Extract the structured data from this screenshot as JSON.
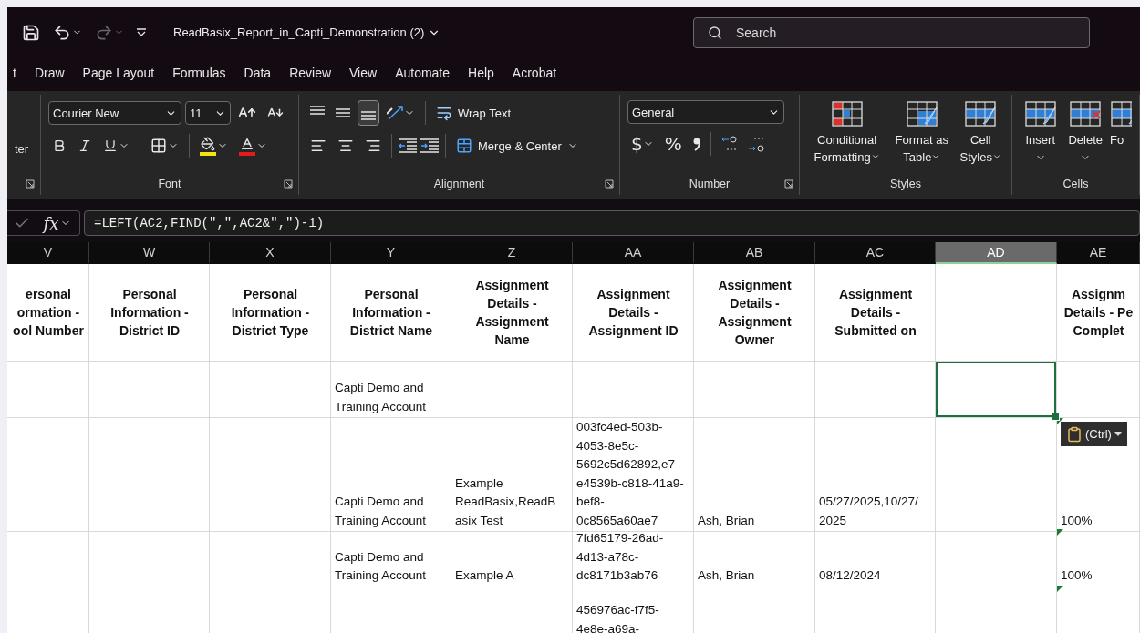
{
  "title_bar": {
    "document_title": "ReadBasix_Report_in_Capti_Demonstration (2)",
    "search": {
      "placeholder": "Search"
    }
  },
  "menu_tabs": [
    {
      "label": "t",
      "selected": false
    },
    {
      "label": "Draw",
      "selected": false
    },
    {
      "label": "Page Layout",
      "selected": false
    },
    {
      "label": "Formulas",
      "selected": false
    },
    {
      "label": "Data",
      "selected": false
    },
    {
      "label": "Review",
      "selected": false
    },
    {
      "label": "View",
      "selected": false
    },
    {
      "label": "Automate",
      "selected": false
    },
    {
      "label": "Help",
      "selected": false
    },
    {
      "label": "Acrobat",
      "selected": false
    }
  ],
  "ribbon": {
    "clipboard": {
      "partial_label": "ter"
    },
    "font": {
      "name": "Courier New",
      "size": "11",
      "label": "Font"
    },
    "alignment": {
      "vertical": [
        {
          "selected": false
        },
        {
          "selected": false
        },
        {
          "selected": true
        }
      ],
      "wrap_text": "Wrap Text",
      "merge": "Merge & Center",
      "label": "Alignment"
    },
    "number": {
      "format": "General",
      "currency": "$",
      "percent": "%",
      "label": "Number"
    },
    "styles": {
      "buttons": [
        "Conditional Formatting",
        "Format as Table",
        "Cell Styles"
      ],
      "label": "Styles"
    },
    "cells": {
      "buttons": [
        "Insert",
        "Delete",
        "Fo"
      ],
      "label": "Cells"
    }
  },
  "formula_bar": {
    "fx": "fx",
    "formula": "=LEFT(AC2,FIND(\",\",AC2&\",\")-1)"
  },
  "sheet": {
    "columns": [
      {
        "label": "V",
        "selected": false,
        "header": "ersonal\normation -\nool Number"
      },
      {
        "label": "W",
        "selected": false,
        "header": "Personal\nInformation -\nDistrict ID"
      },
      {
        "label": "X",
        "selected": false,
        "header": "Personal\nInformation -\nDistrict Type"
      },
      {
        "label": "Y",
        "selected": false,
        "header": "Personal\nInformation -\nDistrict Name"
      },
      {
        "label": "Z",
        "selected": false,
        "header": "Assignment\nDetails -\nAssignment\nName"
      },
      {
        "label": "AA",
        "selected": false,
        "header": "Assignment\nDetails -\nAssignment ID"
      },
      {
        "label": "AB",
        "selected": false,
        "header": "Assignment\nDetails -\nAssignment\nOwner"
      },
      {
        "label": "AC",
        "selected": false,
        "header": "Assignment\nDetails -\nSubmitted on"
      },
      {
        "label": "AD",
        "selected": true
      },
      {
        "label": "AE",
        "selected": false,
        "header": "Assignm\nDetails - Pe\nComplet"
      }
    ],
    "rows": [
      {
        "selected": true,
        "flagged": false,
        "cells": [
          {},
          {},
          {},
          {
            "text": "Capti Demo and\nTraining Account"
          },
          {},
          {},
          {},
          {},
          {},
          {}
        ]
      },
      {
        "selected": false,
        "flagged": true,
        "cells": [
          {},
          {},
          {},
          {
            "text": "Capti Demo and\nTraining Account"
          },
          {
            "text": "Example\nReadBasix,ReadB\nasix Test"
          },
          {
            "text": "003fc4ed-503b-\n4053-8e5c-\n5692c5d62892,e7\ne4539b-c818-41a9-\nbef8-\n0c8565a60ae7"
          },
          {
            "text": "Ash, Brian"
          },
          {
            "text": "05/27/2025,10/27/\n2025"
          },
          {},
          {
            "text": "100%"
          }
        ]
      },
      {
        "selected": false,
        "flagged": true,
        "cells": [
          {},
          {},
          {},
          {
            "text": "Capti Demo and\nTraining Account"
          },
          {
            "text": "Example A"
          },
          {
            "text": "7fd65179-26ad-\n4d13-a78c-\ndc8171b3ab76"
          },
          {
            "text": "Ash, Brian"
          },
          {
            "text": "08/12/2024"
          },
          {},
          {
            "text": "100%"
          }
        ]
      },
      {
        "selected": false,
        "flagged": true,
        "cells": [
          {},
          {},
          {},
          {},
          {},
          {
            "text": "456976ac-f7f5-\n4e8e-a69a-"
          },
          {},
          {},
          {},
          {}
        ]
      }
    ]
  },
  "paste_options": {
    "label": "(Ctrl)"
  }
}
